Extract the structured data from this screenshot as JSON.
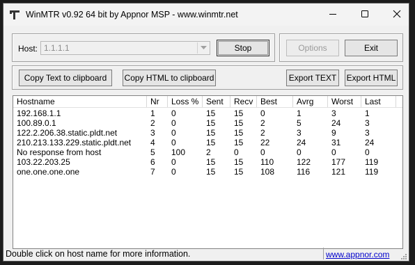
{
  "window": {
    "title": "WinMTR v0.92 64 bit by Appnor MSP - www.winmtr.net"
  },
  "controls": {
    "host_label": "Host:",
    "host_value": "1.1.1.1",
    "stop_label": "Stop",
    "options_label": "Options",
    "exit_label": "Exit"
  },
  "toolbar": {
    "copy_text": "Copy Text to clipboard",
    "copy_html": "Copy HTML to clipboard",
    "export_text": "Export TEXT",
    "export_html": "Export HTML"
  },
  "table": {
    "columns": [
      "Hostname",
      "Nr",
      "Loss %",
      "Sent",
      "Recv",
      "Best",
      "Avrg",
      "Worst",
      "Last"
    ],
    "rows": [
      [
        "192.168.1.1",
        "1",
        "0",
        "15",
        "15",
        "0",
        "1",
        "3",
        "1"
      ],
      [
        "100.89.0.1",
        "2",
        "0",
        "15",
        "15",
        "2",
        "5",
        "24",
        "3"
      ],
      [
        "122.2.206.38.static.pldt.net",
        "3",
        "0",
        "15",
        "15",
        "2",
        "3",
        "9",
        "3"
      ],
      [
        "210.213.133.229.static.pldt.net",
        "4",
        "0",
        "15",
        "15",
        "22",
        "24",
        "31",
        "24"
      ],
      [
        "No response from host",
        "5",
        "100",
        "2",
        "0",
        "0",
        "0",
        "0",
        "0"
      ],
      [
        "103.22.203.25",
        "6",
        "0",
        "15",
        "15",
        "110",
        "122",
        "177",
        "119"
      ],
      [
        "one.one.one.one",
        "7",
        "0",
        "15",
        "15",
        "108",
        "116",
        "121",
        "119"
      ]
    ]
  },
  "status": {
    "message": "Double click on host name for more information.",
    "link": "www.appnor.com"
  },
  "icons": {
    "app": "pickaxe-icon",
    "minimize": "minimize-icon",
    "maximize": "maximize-icon",
    "close": "close-icon",
    "dropdown": "chevron-down-icon"
  }
}
